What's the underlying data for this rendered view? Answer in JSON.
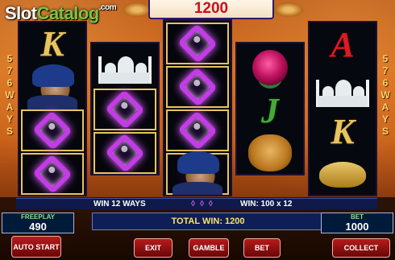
{
  "logo": {
    "main": "Slot",
    "accent": "Catalog",
    "suffix": ".com"
  },
  "balance_display": "1200",
  "side_text": [
    "5",
    "7",
    "6",
    "W",
    "A",
    "Y",
    "S"
  ],
  "info": {
    "win_ways": "WIN 12 WAYS",
    "win_calc": "WIN: 100 x 12"
  },
  "meters": {
    "freeplay": {
      "label": "FREEPLAY",
      "value": "490"
    },
    "bet": {
      "label": "BET",
      "value": "1000"
    }
  },
  "total_win": "TOTAL WIN: 1200",
  "buttons": {
    "auto_start": "AUTO START",
    "exit": "EXIT",
    "gamble": "GAMBLE",
    "bet": "BET",
    "collect": "COLLECT"
  },
  "symbols": {
    "k": "K",
    "a": "A",
    "j": "J"
  },
  "colors": {
    "accent_green": "#7cc441",
    "balance_red": "#c8101e",
    "win_purple": "#c43be8"
  }
}
